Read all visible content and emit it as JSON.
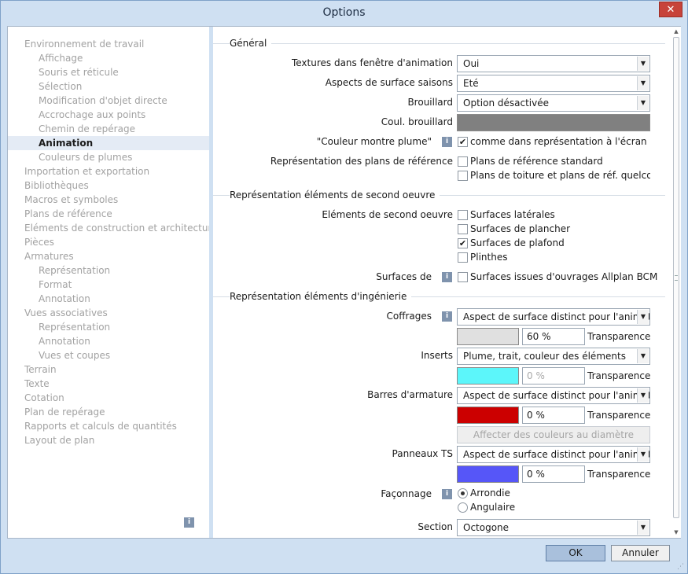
{
  "window": {
    "title": "Options",
    "close_glyph": "✕"
  },
  "nav": {
    "items": [
      {
        "label": "Environnement de travail",
        "level": 0
      },
      {
        "label": "Affichage",
        "level": 1
      },
      {
        "label": "Souris et réticule",
        "level": 1
      },
      {
        "label": "Sélection",
        "level": 1
      },
      {
        "label": "Modification d'objet directe",
        "level": 1
      },
      {
        "label": "Accrochage aux points",
        "level": 1
      },
      {
        "label": "Chemin de repérage",
        "level": 1
      },
      {
        "label": "Animation",
        "level": 1,
        "active": true
      },
      {
        "label": "Couleurs de plumes",
        "level": 1
      },
      {
        "label": "Importation et exportation",
        "level": 0
      },
      {
        "label": "Bibliothèques",
        "level": 0
      },
      {
        "label": "Macros et symboles",
        "level": 0
      },
      {
        "label": "Plans de référence",
        "level": 0
      },
      {
        "label": "Eléments de construction et architecture",
        "level": 0
      },
      {
        "label": "Pièces",
        "level": 0
      },
      {
        "label": "Armatures",
        "level": 0
      },
      {
        "label": "Représentation",
        "level": 1
      },
      {
        "label": "Format",
        "level": 1
      },
      {
        "label": "Annotation",
        "level": 1
      },
      {
        "label": "Vues associatives",
        "level": 0
      },
      {
        "label": "Représentation",
        "level": 1
      },
      {
        "label": "Annotation",
        "level": 1
      },
      {
        "label": "Vues et coupes",
        "level": 1
      },
      {
        "label": "Terrain",
        "level": 0
      },
      {
        "label": "Texte",
        "level": 0
      },
      {
        "label": "Cotation",
        "level": 0
      },
      {
        "label": "Plan de repérage",
        "level": 0
      },
      {
        "label": "Rapports et calculs de quantités",
        "level": 0
      },
      {
        "label": "Layout de plan",
        "level": 0
      }
    ],
    "info_glyph": "i"
  },
  "general": {
    "title": "Général",
    "textures_label": "Textures dans fenêtre d'animation",
    "textures_value": "Oui",
    "seasons_label": "Aspects de surface saisons",
    "seasons_value": "Eté",
    "fog_label": "Brouillard",
    "fog_value": "Option désactivée",
    "fog_color_label": "Coul. brouillard",
    "pen_color_label": "\"Couleur montre plume\"",
    "pen_color_option": "comme dans représentation à l'écran",
    "ref_planes_label": "Représentation des plans de référence",
    "ref_plane_standard": "Plans de référence standard",
    "ref_plane_roof": "Plans de toiture et plans de réf. quelconques"
  },
  "finishing": {
    "title": "Représentation éléments de second oeuvre",
    "elements_label": "Eléments de second oeuvre",
    "side_surfaces": "Surfaces latérales",
    "floor_surfaces": "Surfaces de plancher",
    "ceiling_surfaces": "Surfaces de plafond",
    "skirting": "Plinthes",
    "surfaces_label": "Surfaces de",
    "bcm_surfaces": "Surfaces issues d'ouvrages Allplan BCM"
  },
  "engineering": {
    "title": "Représentation éléments d'ingénierie",
    "formwork_label": "Coffrages",
    "formwork_value": "Aspect de surface distinct pour l'animation",
    "formwork_transparency": "60 %",
    "inserts_label": "Inserts",
    "inserts_value": "Plume, trait, couleur des éléments",
    "inserts_transparency": "0 %",
    "rebar_label": "Barres d'armature",
    "rebar_value": "Aspect de surface distinct pour l'animation",
    "rebar_transparency": "0 %",
    "assign_colors_button": "Affecter des couleurs au diamètre",
    "ts_panels_label": "Panneaux TS",
    "ts_panels_value": "Aspect de surface distinct pour l'animation",
    "ts_panels_transparency": "0 %",
    "transparency_label": "Transparence",
    "shaping_label": "Façonnage",
    "shaping_round": "Arrondie",
    "shaping_angular": "Angulaire",
    "section_label": "Section",
    "section_value": "Octogone"
  },
  "colors": {
    "fog": "#808080",
    "formwork": "#e0e0e0",
    "inserts": "#5cf6fa",
    "rebar": "#cc0000",
    "ts_panels": "#5656f8"
  },
  "footer": {
    "ok": "OK",
    "cancel": "Annuler"
  }
}
